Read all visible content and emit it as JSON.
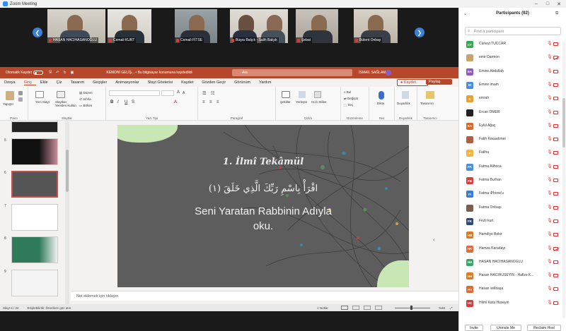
{
  "window": {
    "title": "Zoom Meeting"
  },
  "videos": [
    {
      "name": "HASAN HACIHASANOĞLU"
    },
    {
      "name": "Cemali KURT"
    },
    {
      "name": "Cemali FİTSE"
    },
    {
      "name": "Büşra Balçık - Salih Balçık"
    },
    {
      "name": "Şebat"
    },
    {
      "name": "Bülent Onbay"
    }
  ],
  "ppt": {
    "autosave": "Otomatik Kaydet",
    "doc_title": "KEMDNİ GELİŞ... • Bu bilgisayar konumuna kaydedildi",
    "search": "Ara",
    "user": "İSMAİL SAĞLAM",
    "menu": [
      "Dosya",
      "Giriş",
      "Ekle",
      "Çiz",
      "Tasarım",
      "Geçişler",
      "Animasyonlar",
      "Slayt Gösterisi",
      "Kaydet",
      "Gözden Geçir",
      "Görünüm",
      "Yardım"
    ],
    "record_btn": "Kaydet",
    "share_btn": "Paylaş",
    "ribbon_groups": [
      "Pano",
      "Slaytlar",
      "Yazı Tipi",
      "Paragraf",
      "Çizim",
      "Düzenleme",
      "Ses",
      "Duyarlılık",
      "Tasarımcı"
    ],
    "ribbon_labels": {
      "paste": "Yapıştır",
      "new_slide": "Yeni Slayt",
      "reuse": "Slaytları Yeniden Kullan",
      "layout": "Düzen",
      "reset": "Sıfırla",
      "section": "Bölüm",
      "shapes": "Şekiller",
      "arrange": "Yerleştir",
      "quick_styles": "Hızlı Stiller",
      "find": "Bul",
      "replace": "Değiştir",
      "select": "Seç",
      "dictate": "Dikte",
      "sensitivity": "Duyarlılık",
      "designer": "Tasarımcı"
    },
    "slide_numbers": [
      "5",
      "6",
      "7",
      "8",
      "9"
    ],
    "slide": {
      "title": "1. İlmî Tekâmül",
      "arabic": "اقْرَأْ بِاسْمِ رَبِّكَ الَّذِي خَلَقَ (١)",
      "line1": "Seni Yaratan Rabbinin Adıyla",
      "line2": "oku."
    },
    "notes": "Not eklemek için tıklayın",
    "status_left": "Slayt 6 / 24",
    "status_access": "Erişilebilirlik: Önerilere göz atın",
    "status_notes": "Notlar",
    "status_zoom": "%68"
  },
  "panel": {
    "title": "Participants (92)",
    "search_placeholder": "Find a participant",
    "participants": [
      {
        "initials": "CT",
        "name": "Cüneyt TÜCCAR",
        "color": "#35a853",
        "cam_off": false
      },
      {
        "initials": "",
        "name": "emir Darmon",
        "color": "#c8a36a",
        "cam_off": true
      },
      {
        "initials": "EA",
        "name": "Emine Abdullah",
        "color": "#8e5bc4",
        "cam_off": false
      },
      {
        "initials": "EI",
        "name": "Emine imam",
        "color": "#4a90d9",
        "cam_off": false
      },
      {
        "initials": "E",
        "name": "emrah",
        "color": "#e9a030",
        "cam_off": false
      },
      {
        "initials": "",
        "name": "Ercan ÖMER",
        "color": "#222222",
        "cam_off": false
      },
      {
        "initials": "EA",
        "name": "Eylül Ağaç",
        "color": "#d26a2a",
        "cam_off": false
      },
      {
        "initials": "",
        "name": "Fatih Kocaahmet",
        "color": "#b06040",
        "cam_off": false
      },
      {
        "initials": "F",
        "name": "Fatiha",
        "color": "#f0b840",
        "cam_off": false
      },
      {
        "initials": "FA",
        "name": "Fatma Alihoca",
        "color": "#4a90d9",
        "cam_off": false
      },
      {
        "initials": "FB",
        "name": "Fatma Burhan",
        "color": "#d94040",
        "cam_off": false
      },
      {
        "initials": "FI",
        "name": "Fatma iPhone'u",
        "color": "#3a7bd5",
        "cam_off": false
      },
      {
        "initials": "",
        "name": "Fatma Onbaşı",
        "color": "#7a6050",
        "cam_off": false
      },
      {
        "initials": "FK",
        "name": "Fezli kurt",
        "color": "#2f4a7a",
        "cam_off": false
      },
      {
        "initials": "HB",
        "name": "Hamdiye Bekir",
        "color": "#e07a20",
        "cam_off": false
      },
      {
        "initials": "HK",
        "name": "Hamza Karadayı",
        "color": "#e06a40",
        "cam_off": true
      },
      {
        "initials": "HH",
        "name": "HASAN HACIHASANOĞLU",
        "color": "#35a868",
        "cam_off": false
      },
      {
        "initials": "HH",
        "name": "Hasan HACIHÜSEYİN - Hafize K...",
        "color": "#e07a20",
        "cam_off": false
      },
      {
        "initials": "HV",
        "name": "Hasan velibaşa",
        "color": "#e06a30",
        "cam_off": false
      },
      {
        "initials": "HK",
        "name": "Hilmi Kara Huseyin",
        "color": "#d93a3a",
        "cam_off": false
      }
    ],
    "buttons": {
      "invite": "Invite",
      "unmute": "Unmute Me",
      "reclaim": "Reclaim Host"
    }
  }
}
